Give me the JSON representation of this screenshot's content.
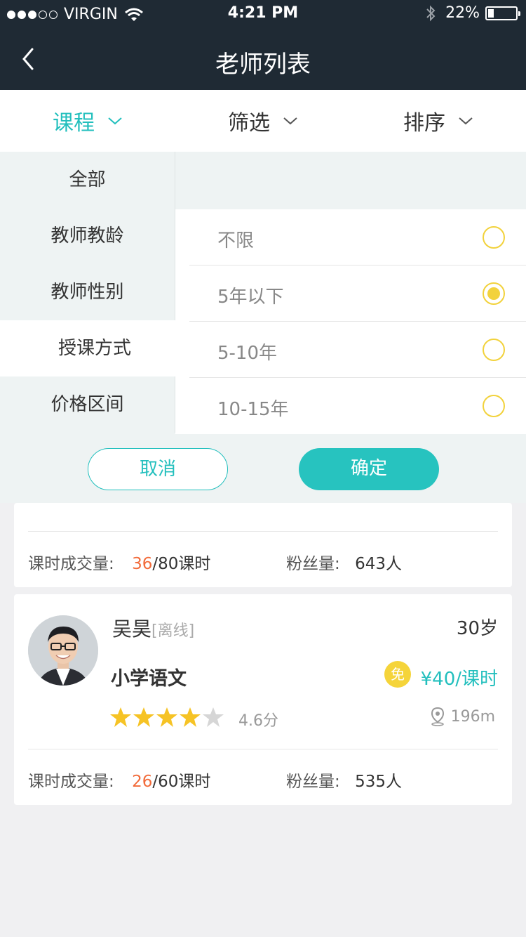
{
  "status_bar": {
    "carrier": "VIRGIN",
    "time": "4:21 PM",
    "battery": "22%",
    "battery_level": 0.22
  },
  "nav": {
    "title": "老师列表"
  },
  "tabs": [
    {
      "label": "课程"
    },
    {
      "label": "筛选"
    },
    {
      "label": "排序"
    }
  ],
  "filter": {
    "categories": [
      "全部",
      "教师教龄",
      "教师性别",
      "授课方式",
      "价格区间"
    ],
    "options": [
      "不限",
      "5年以下",
      "5-10年",
      "10-15年"
    ],
    "selected_option": "5年以下",
    "cancel_label": "取消",
    "confirm_label": "确定"
  },
  "teachers": [
    {
      "sales_label": "课时成交量:",
      "sales_done": "36",
      "sales_total": "/80课时",
      "fans_label": "粉丝量:",
      "fans": "643人"
    },
    {
      "name": "吴昊",
      "status": "[离线]",
      "age": "30岁",
      "subject": "小学语文",
      "free_badge": "免",
      "price": "¥40/课时",
      "rating": 4.6,
      "rating_text": "4.6分",
      "distance": "196m",
      "sales_label": "课时成交量:",
      "sales_done": "26",
      "sales_total": "/60课时",
      "fans_label": "粉丝量:",
      "fans": "535人"
    }
  ]
}
